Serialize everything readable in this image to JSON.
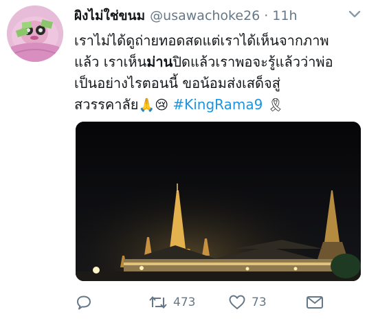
{
  "tweet": {
    "display_name": "ผิงไม่ใช่ขนม",
    "handle": "@usawachoke26",
    "separator": "·",
    "time": "11h",
    "text_lines": [
      "เราไม่ได้ดูถ่ายทอดสดแต่เราได้เห็นจากภาพ",
      [
        "แล้ว เราเห็น",
        "ม่าน",
        "ปิดแล้วเราพอจะรู้แล้วว่าพ่อ"
      ],
      "เป็นอย่างไรตอนนี้ ขอน้อมส่งเสด็จสู่",
      [
        "สวรรคาลัย",
        "#KingRama9"
      ]
    ],
    "emojis": [
      "praying-hands",
      "crying-face",
      "black-ribbon"
    ],
    "media_description": "Illuminated temple at night",
    "actions": {
      "reply_count": "",
      "retweet_count": "473",
      "like_count": "73"
    }
  },
  "colors": {
    "link": "#1b95e0",
    "muted": "#657786",
    "text": "#14171a",
    "avatar_bg": "#e6b9d6"
  }
}
